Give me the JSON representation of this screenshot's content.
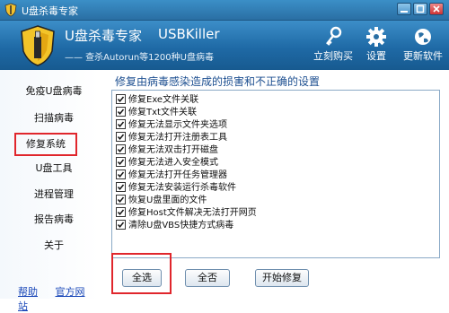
{
  "window": {
    "title": "U盘杀毒专家"
  },
  "header": {
    "title": "U盘杀毒专家",
    "title_en": "USBKiller",
    "subtitle": "—— 查杀Autorun等1200种U盘病毒",
    "tools": [
      {
        "label": "立刻购买",
        "icon": "key-icon"
      },
      {
        "label": "设置",
        "icon": "gear-icon"
      },
      {
        "label": "更新软件",
        "icon": "globe-icon"
      }
    ]
  },
  "sidebar": {
    "items": [
      {
        "label": "免疫U盘病毒"
      },
      {
        "label": "扫描病毒"
      },
      {
        "label": "修复系统",
        "active": true
      },
      {
        "label": "U盘工具"
      },
      {
        "label": "进程管理"
      },
      {
        "label": "报告病毒"
      },
      {
        "label": "关于"
      }
    ],
    "help": "帮助",
    "website": "官方网站"
  },
  "content": {
    "title": "修复由病毒感染造成的损害和不正确的设置",
    "items": [
      {
        "label": "修复Exe文件关联",
        "checked": true
      },
      {
        "label": "修复Txt文件关联",
        "checked": true
      },
      {
        "label": "修复无法显示文件夹选项",
        "checked": true
      },
      {
        "label": "修复无法打开注册表工具",
        "checked": true
      },
      {
        "label": "修复无法双击打开磁盘",
        "checked": true
      },
      {
        "label": "修复无法进入安全模式",
        "checked": true
      },
      {
        "label": "修复无法打开任务管理器",
        "checked": true
      },
      {
        "label": "修复无法安装运行杀毒软件",
        "checked": true
      },
      {
        "label": "恢复U盘里面的文件",
        "checked": true
      },
      {
        "label": "修复Host文件解决无法打开网页",
        "checked": true
      },
      {
        "label": "清除U盘VBS快捷方式病毒",
        "checked": true
      }
    ],
    "buttons": {
      "select_all": "全选",
      "select_none": "全否",
      "start_repair": "开始修复"
    }
  },
  "colors": {
    "header": "#1f6aa6",
    "highlight": "#e0262c",
    "link": "#1846b8"
  }
}
